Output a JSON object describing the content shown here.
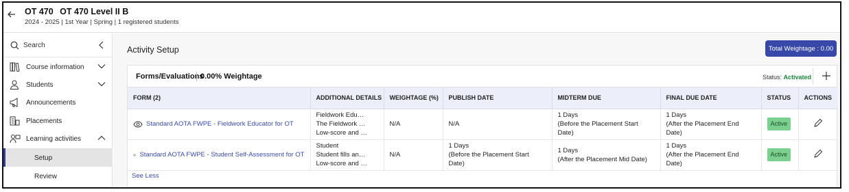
{
  "header": {
    "course_code": "OT 470",
    "course_name": "OT 470 Level II B",
    "subtitle": "2024 - 2025 | 1st Year | Spring | 1 registered students"
  },
  "sidebar": {
    "search_label": "Search",
    "items": [
      {
        "label": "Course information",
        "icon": "book-icon",
        "expandable": true
      },
      {
        "label": "Students",
        "icon": "person-icon",
        "expandable": true
      },
      {
        "label": "Announcements",
        "icon": "megaphone-icon",
        "expandable": false
      },
      {
        "label": "Placements",
        "icon": "placements-icon",
        "expandable": false
      },
      {
        "label": "Learning activities",
        "icon": "learning-icon",
        "expandable": true,
        "expanded": true
      }
    ],
    "sub_items": [
      {
        "label": "Setup",
        "active": true
      },
      {
        "label": "Review",
        "active": false
      }
    ]
  },
  "main": {
    "title": "Activity Setup",
    "total_button": "Total Weightage : 0.00",
    "card": {
      "title": "Forms/Evaluations",
      "weightage": "0.00% Weightage",
      "status_label": "Status:",
      "status_value": "Activated",
      "see_less": "See Less"
    },
    "table": {
      "columns": [
        "FORM (2)",
        "ADDITIONAL DETAILS",
        "WEIGHTAGE (%)",
        "PUBLISH DATE",
        "MIDTERM DUE",
        "FINAL DUE DATE",
        "STATUS",
        "ACTIONS"
      ],
      "rows": [
        {
          "form": "Standard AOTA FWPE - Fieldwork Educator for OT",
          "details": [
            "Fieldwork Edu…",
            "The Fieldwork …",
            "Low-score and …"
          ],
          "weightage": "N/A",
          "publish": [
            "N/A",
            ""
          ],
          "midterm": [
            "1 Days",
            "(Before the Placement Start Date)"
          ],
          "final": [
            "1 Days",
            "(After the Placement End Date)"
          ],
          "status": "Active"
        },
        {
          "form": "Standard AOTA FWPE - Student Self-Assessment for OT",
          "details": [
            "Student",
            "Student fills an…",
            "Low-score and …"
          ],
          "weightage": "N/A",
          "publish": [
            "1 Days",
            "(Before the Placement Start Date)"
          ],
          "midterm": [
            "1 Days",
            "(After the Placement Mid Date)"
          ],
          "final": [
            "1 Days",
            "(After the Placement End Date)"
          ],
          "status": "Active"
        }
      ]
    }
  },
  "colors": {
    "accent": "#3848a8",
    "link": "#3a4ab0",
    "status_active_bg": "#7bd08f",
    "activated_text": "#1a8a3a",
    "table_header_bg": "#eceef9"
  }
}
